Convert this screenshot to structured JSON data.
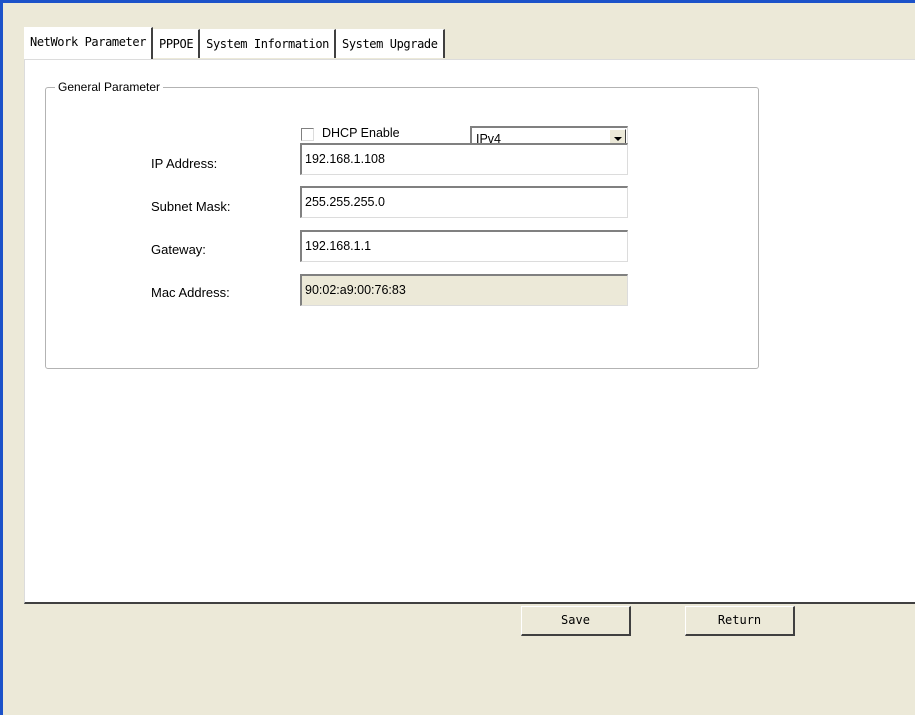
{
  "tabs": [
    {
      "label": "NetWork Parameter",
      "active": true
    },
    {
      "label": "PPPOE",
      "active": false
    },
    {
      "label": "System Information",
      "active": false
    },
    {
      "label": "System Upgrade",
      "active": false
    }
  ],
  "general": {
    "title": "General Parameter",
    "dhcp_label": "DHCP Enable",
    "dhcp_checked": false,
    "ip_version": "IPv4",
    "fields": [
      {
        "label": "IP Address:",
        "value": "192.168.1.108",
        "readonly": false
      },
      {
        "label": "Subnet Mask:",
        "value": "255.255.255.0",
        "readonly": false
      },
      {
        "label": "Gateway:",
        "value": "192.168.1.1",
        "readonly": false
      },
      {
        "label": "Mac Address:",
        "value": "90:02:a9:00:76:83",
        "readonly": true
      }
    ]
  },
  "buttons": {
    "save": "Save",
    "return": "Return"
  },
  "colors": {
    "window_border": "#1c52c9",
    "face": "#ece9d8"
  }
}
